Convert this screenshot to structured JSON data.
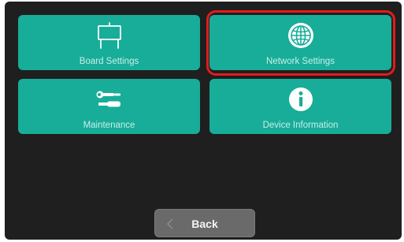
{
  "menu": {
    "items": [
      {
        "label": "Board Settings",
        "icon": "board-icon"
      },
      {
        "label": "Network Settings",
        "icon": "globe-icon",
        "selected": true
      },
      {
        "label": "Maintenance",
        "icon": "wrench-screwdriver-icon"
      },
      {
        "label": "Device Information",
        "icon": "info-icon"
      }
    ]
  },
  "footer": {
    "back_label": "Back"
  },
  "colors": {
    "tile": "#17ad99",
    "background": "#1f1f1f",
    "highlight": "#e31b1b",
    "back_button": "#6a6a6a"
  }
}
